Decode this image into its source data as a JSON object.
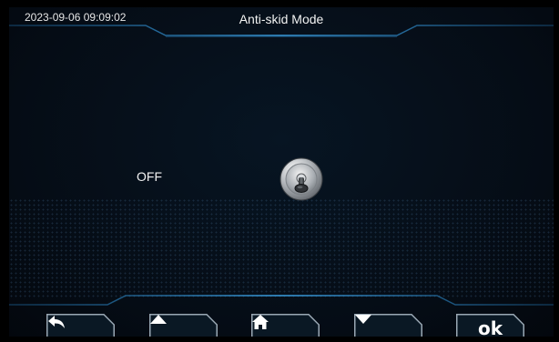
{
  "header": {
    "datetime": "2023-09-06 09:09:02",
    "title": "Anti-skid Mode"
  },
  "main": {
    "state_label": "OFF",
    "toggle_state": "off",
    "toggle_icon": "toggle-switch-icon"
  },
  "footer": {
    "buttons": [
      {
        "name": "back",
        "icon": "back-arrow-icon"
      },
      {
        "name": "up",
        "icon": "up-triangle-icon"
      },
      {
        "name": "home",
        "icon": "home-icon"
      },
      {
        "name": "down",
        "icon": "down-triangle-icon"
      },
      {
        "name": "ok",
        "label": "ok"
      }
    ]
  },
  "colors": {
    "background": "#050c15",
    "accent_line": "#2a86c8",
    "button_fill": "#0a1824",
    "text": "#f2f2f2"
  }
}
